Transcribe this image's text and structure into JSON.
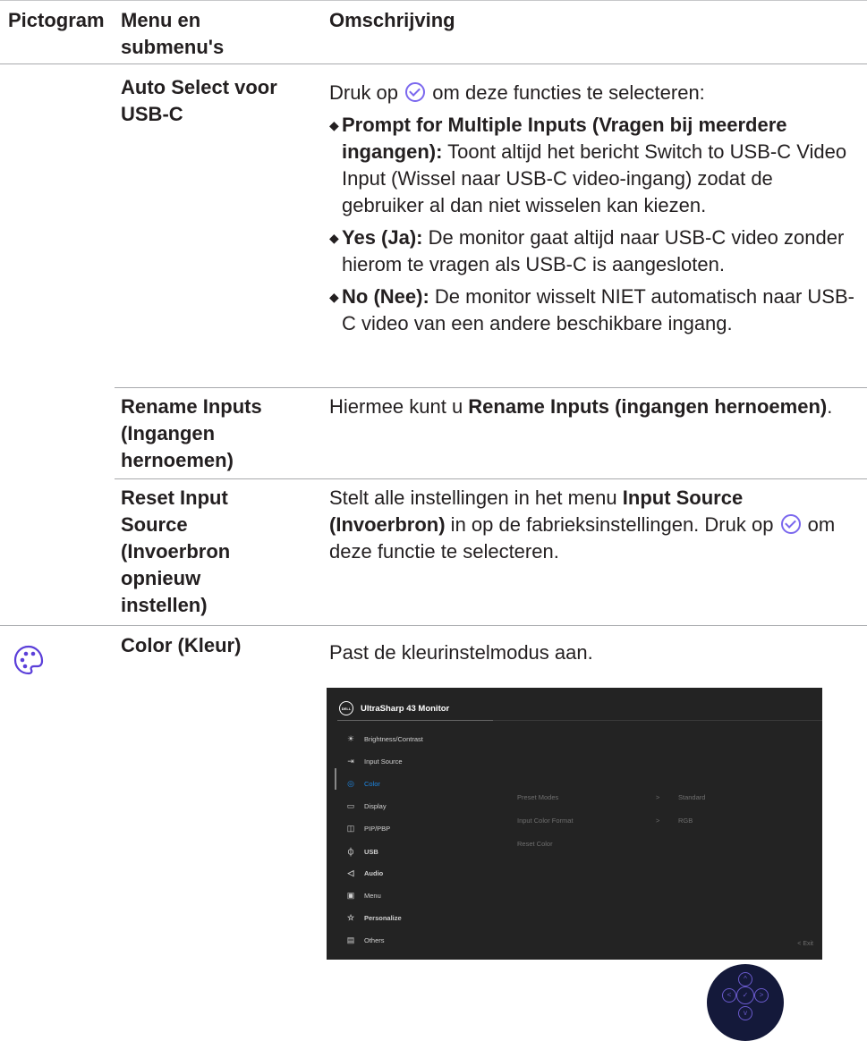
{
  "header": {
    "col1": "Pictogram",
    "col2_line1": "Menu en",
    "col2_line2": "submenu's",
    "col3": "Omschrijving"
  },
  "rows": {
    "auto_select": {
      "label_line1": "Auto Select voor",
      "label_line2": "USB-C",
      "intro_before": "Druk op",
      "intro_after": "om deze functies te selecteren:",
      "b1_bold": "Prompt for Multiple Inputs (Vragen bij meerdere ingangen):",
      "b1_text": " Toont altijd het bericht Switch to USB-C Video Input (Wissel naar USB-C video-ingang) zodat de gebruiker al dan niet wisselen kan kiezen.",
      "b2_bold": "Yes (Ja):",
      "b2_text": " De monitor gaat altijd naar USB-C video zonder hierom te vragen als USB-C is aangesloten.",
      "b3_bold": "No (Nee):",
      "b3_text": " De monitor wisselt NIET automatisch naar USB-C video van een andere beschikbare ingang."
    },
    "rename": {
      "label_line1": "Rename Inputs",
      "label_line2": "(Ingangen",
      "label_line3": "hernoemen)",
      "text_before": "Hiermee kunt u ",
      "text_bold": "Rename Inputs (ingangen hernoemen)",
      "text_after": "."
    },
    "reset": {
      "label_line1": "Reset Input",
      "label_line2": "Source",
      "label_line3": "(Invoerbron",
      "label_line4": "opnieuw",
      "label_line5": "instellen)",
      "text_before": "Stelt alle instellingen in het menu ",
      "text_bold": "Input Source (Invoerbron)",
      "text_mid": " in op de fabrieksinstellingen. Druk op ",
      "text_after": " om deze functie te selecteren."
    },
    "color": {
      "label": "Color (Kleur)",
      "text": "Past de kleurinstelmodus aan."
    }
  },
  "osd": {
    "logo": "DELL",
    "title": "UltraSharp 43 Monitor",
    "menu": [
      {
        "icon": "brightness-icon",
        "glyph": "☀",
        "label": "Brightness/Contrast"
      },
      {
        "icon": "input-source-icon",
        "glyph": "⇥",
        "label": "Input Source"
      },
      {
        "icon": "color-icon",
        "glyph": "◎",
        "label": "Color"
      },
      {
        "icon": "display-icon",
        "glyph": "▭",
        "label": "Display"
      },
      {
        "icon": "pip-pbp-icon",
        "glyph": "◫",
        "label": "PIP/PBP"
      },
      {
        "icon": "usb-icon",
        "glyph": "⏀",
        "label": "USB"
      },
      {
        "icon": "audio-icon",
        "glyph": "◁",
        "label": "Audio"
      },
      {
        "icon": "menu-icon",
        "glyph": "▣",
        "label": "Menu"
      },
      {
        "icon": "personalize-icon",
        "glyph": "☆",
        "label": "Personalize"
      },
      {
        "icon": "others-icon",
        "glyph": "▤",
        "label": "Others"
      }
    ],
    "active_item": "Color",
    "submenu": [
      {
        "label": "Preset Modes",
        "arrow": ">",
        "value": "Standard"
      },
      {
        "label": "Input Color Format",
        "arrow": ">",
        "value": "RGB"
      },
      {
        "label": "Reset Color",
        "arrow": "",
        "value": ""
      }
    ],
    "exit": "<  Exit"
  },
  "joystick": {
    "up": "^",
    "left": "<",
    "center": "✓",
    "right": ">",
    "down": "v"
  },
  "colors": {
    "accent": "#7b68ee",
    "osd_bg": "#232323",
    "osd_active": "#1e88e5"
  }
}
